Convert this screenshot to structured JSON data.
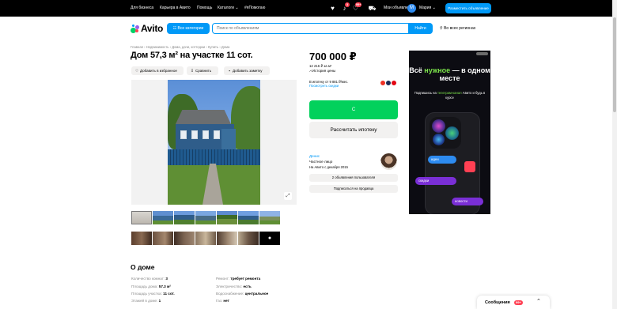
{
  "topbar": {
    "links": [
      "Для бизнеса",
      "Карьера в Авито",
      "Помощь",
      "Каталоги ⌄",
      "#яПомогаю"
    ],
    "badges": {
      "notifications": "3",
      "favorites": "99+"
    },
    "my_ads": "Мои объявления",
    "avatar_letter": "М",
    "user_name": "Мария ⌄",
    "post_button": "Разместить объявление"
  },
  "header": {
    "logo": "Avito",
    "all_categories": "☷ Все категории",
    "search_placeholder": "Поиск по объявлениям",
    "find_button": "Найти",
    "region": "Во всех регионах"
  },
  "listing": {
    "breadcrumb": "Главная › Недвижимость › Дома, дачи, коттеджи › Купить › Дома",
    "title": "Дом 57,3 м² на участке 11 сот.",
    "actions": [
      {
        "icon": "♡",
        "label": "Добавить в избранное"
      },
      {
        "icon": "⠿",
        "label": "Сравнить"
      },
      {
        "icon": "▪",
        "label": "Добавить заметку"
      }
    ],
    "expand_icon": "⤢",
    "more_photos_icon": "●"
  },
  "price_block": {
    "price": "700 000 ₽",
    "per_meter": "12 216 ₽ за м²",
    "history": "История цены",
    "mortgage_text": "В ипотеку от 9 881 ₽/мес.",
    "mortgage_link": "Посмотреть скидки",
    "call_button": "C",
    "mortgage_button": "Рассчитать ипотеку"
  },
  "seller": {
    "name": "Денис",
    "type": "Частное лицо",
    "since": "На Авито с декабря 2015",
    "ads_button": "2 объявления пользователя",
    "subscribe_button": "Подписаться на продавца"
  },
  "ad": {
    "headline_1": "Всё ",
    "headline_accent": "нужное",
    "headline_2": " — в одном месте",
    "sub_1": "Подпишись на ",
    "sub_accent": "телеграм-канал",
    "sub_2": " Авито и будь в курсе",
    "pill_1": "идеи",
    "pill_2": "скидки",
    "pill_3": "новости"
  },
  "about": {
    "heading": "О доме",
    "left": [
      {
        "k": "Количество комнат: ",
        "v": "3"
      },
      {
        "k": "Площадь дома: ",
        "v": "57.3 м²"
      },
      {
        "k": "Площадь участка: ",
        "v": "11 сот."
      },
      {
        "k": "Этажей в доме: ",
        "v": "1"
      }
    ],
    "right": [
      {
        "k": "Ремонт: ",
        "v": "требует ремонта"
      },
      {
        "k": "Электричество: ",
        "v": "есть"
      },
      {
        "k": "Водоснабжение: ",
        "v": "центральное"
      },
      {
        "k": "Газ: ",
        "v": "нет"
      }
    ]
  },
  "messages": {
    "label": "Сообщения",
    "count": "99+"
  },
  "colors": {
    "accent": "#0099f7",
    "call_green": "#02d15c",
    "badge_red": "#ff4053",
    "ad_green": "#7ce34b"
  }
}
